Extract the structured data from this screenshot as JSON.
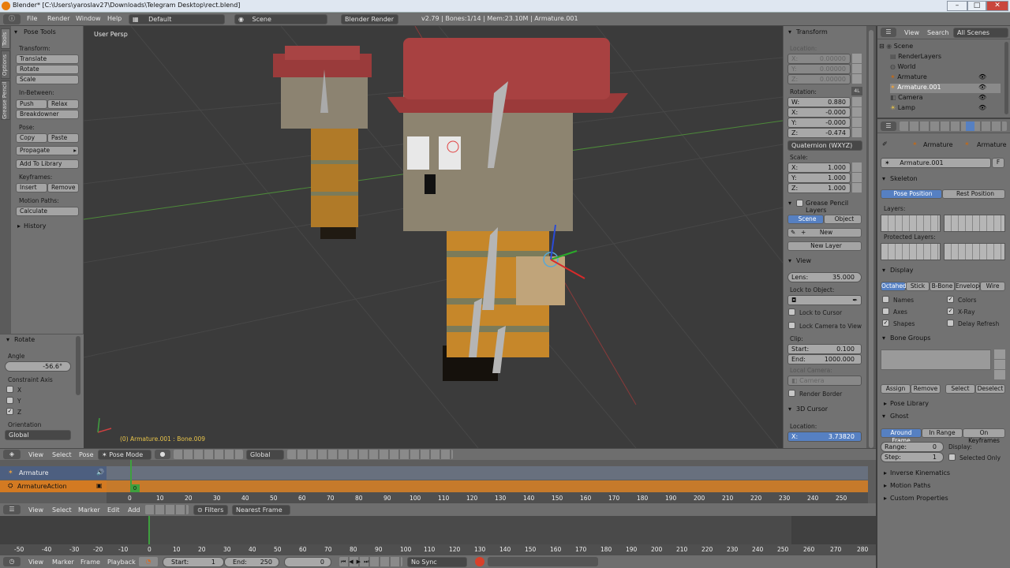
{
  "window": {
    "title": "Blender* [C:\\Users\\yaroslav27\\Downloads\\Telegram Desktop\\rect.blend]"
  },
  "top_menu": {
    "items": [
      "File",
      "Render",
      "Window",
      "Help"
    ],
    "layout": "Default",
    "scene": "Scene",
    "engine": "Blender Render",
    "stats": "v2.79 | Bones:1/14 | Mem:23.10M | Armature.001"
  },
  "tool_tabs": [
    "Tools",
    "Options",
    "Grease Pencil"
  ],
  "pose_tools": {
    "title": "Pose Tools",
    "transform_label": "Transform:",
    "transform": [
      "Translate",
      "Rotate",
      "Scale"
    ],
    "inbetween_label": "In-Between:",
    "push": "Push",
    "relax": "Relax",
    "breakdowner": "Breakdowner",
    "pose_label": "Pose:",
    "copy": "Copy",
    "paste": "Paste",
    "propagate": "Propagate",
    "add_library": "Add To Library",
    "keyframes_label": "Keyframes:",
    "insert": "Insert",
    "remove": "Remove",
    "motion_label": "Motion Paths:",
    "calculate": "Calculate",
    "history": "History"
  },
  "rotate_op": {
    "title": "Rotate",
    "angle_label": "Angle",
    "angle": "-56.6°",
    "constraint_label": "Constraint Axis",
    "axes": [
      "X",
      "Y",
      "Z"
    ],
    "orientation_label": "Orientation",
    "orientation": "Global"
  },
  "viewport": {
    "view_name": "User Persp",
    "status": "(0) Armature.001 : Bone.009"
  },
  "npanel": {
    "transform_title": "Transform",
    "location_label": "Location:",
    "location": [
      {
        "axis": "X:",
        "value": "0.00000"
      },
      {
        "axis": "Y:",
        "value": "0.00000"
      },
      {
        "axis": "Z:",
        "value": "0.00000"
      }
    ],
    "rotation_label": "Rotation:",
    "rot_badge": "4L",
    "rotation": [
      {
        "axis": "W:",
        "value": "0.880"
      },
      {
        "axis": "X:",
        "value": "-0.000"
      },
      {
        "axis": "Y:",
        "value": "-0.000"
      },
      {
        "axis": "Z:",
        "value": "-0.474"
      }
    ],
    "rot_mode": "Quaternion (WXYZ)",
    "scale_label": "Scale:",
    "scale": [
      {
        "axis": "X:",
        "value": "1.000"
      },
      {
        "axis": "Y:",
        "value": "1.000"
      },
      {
        "axis": "Z:",
        "value": "1.000"
      }
    ],
    "gp_title": "Grease Pencil Layers",
    "gp_scene": "Scene",
    "gp_object": "Object",
    "gp_new": "New",
    "gp_new_layer": "New Layer",
    "view_title": "View",
    "lens_label": "Lens:",
    "lens": "35.000",
    "lock_obj_label": "Lock to Object:",
    "lock_cursor": "Lock to Cursor",
    "lock_camera": "Lock Camera to View",
    "clip_label": "Clip:",
    "clip_start_label": "Start:",
    "clip_start": "0.100",
    "clip_end_label": "End:",
    "clip_end": "1000.000",
    "local_camera_label": "Local Camera:",
    "camera": "Camera",
    "render_border": "Render Border",
    "cursor_title": "3D Cursor",
    "cursor_loc_label": "Location:",
    "cursor_x_label": "X:",
    "cursor_x": "3.73820"
  },
  "outliner": {
    "view": "View",
    "search": "Search",
    "scenes": "All Scenes",
    "items": [
      {
        "name": "Scene",
        "indent": 0
      },
      {
        "name": "RenderLayers",
        "indent": 1
      },
      {
        "name": "World",
        "indent": 1
      },
      {
        "name": "Armature",
        "indent": 1
      },
      {
        "name": "Armature.001",
        "indent": 1
      },
      {
        "name": "Camera",
        "indent": 1
      },
      {
        "name": "Lamp",
        "indent": 1
      }
    ]
  },
  "properties": {
    "breadcrumb": [
      "Armature",
      "Armature"
    ],
    "name": "Armature.001",
    "fake": "F",
    "skeleton_title": "Skeleton",
    "pose_position": "Pose Position",
    "rest_position": "Rest Position",
    "layers_label": "Layers:",
    "protected_label": "Protected Layers:",
    "display_title": "Display",
    "display_modes": [
      "Octahed",
      "Stick",
      "B-Bone",
      "Envelope",
      "Wire"
    ],
    "names": "Names",
    "colors": "Colors",
    "axes": "Axes",
    "xray": "X-Ray",
    "shapes": "Shapes",
    "delay": "Delay Refresh",
    "bone_groups_title": "Bone Groups",
    "assign": "Assign",
    "remove": "Remove",
    "select": "Select",
    "deselect": "Deselect",
    "pose_library": "Pose Library",
    "ghost_title": "Ghost",
    "ghost_modes": [
      "Around Frame",
      "In Range",
      "On Keyframes"
    ],
    "range_label": "Range:",
    "range": "0",
    "step_label": "Step:",
    "step": "1",
    "display_label": "Display:",
    "selected_only": "Selected Only",
    "ik": "Inverse Kinematics",
    "motion_paths": "Motion Paths",
    "custom_props": "Custom Properties"
  },
  "view_header": {
    "menus": [
      "View",
      "Select",
      "Pose"
    ],
    "mode": "Pose Mode",
    "orientation": "Global"
  },
  "dopesheet": {
    "channels": [
      "Armature",
      "ArmatureAction"
    ],
    "current_frame": "0",
    "ticks": [
      "0",
      "10",
      "20",
      "30",
      "40",
      "50",
      "60",
      "70",
      "80",
      "90",
      "100",
      "110",
      "120",
      "130",
      "140",
      "150",
      "160",
      "170",
      "180",
      "190",
      "200",
      "210",
      "220",
      "230",
      "240",
      "250"
    ]
  },
  "graph_header": {
    "menus": [
      "View",
      "Select",
      "Marker",
      "Edit",
      "Add"
    ],
    "filters": "Filters",
    "interp": "Nearest Frame"
  },
  "timeline": {
    "ticks": [
      "-50",
      "-40",
      "-30",
      "-20",
      "-10",
      "0",
      "10",
      "20",
      "30",
      "40",
      "50",
      "60",
      "70",
      "80",
      "90",
      "100",
      "110",
      "120",
      "130",
      "140",
      "150",
      "160",
      "170",
      "180",
      "190",
      "200",
      "210",
      "220",
      "230",
      "240",
      "250",
      "260",
      "270",
      "280"
    ]
  },
  "bottom_bar": {
    "menus": [
      "View",
      "Marker",
      "Frame",
      "Playback"
    ],
    "start_label": "Start:",
    "start": "1",
    "end_label": "End:",
    "end": "250",
    "current": "0",
    "sync": "No Sync"
  }
}
